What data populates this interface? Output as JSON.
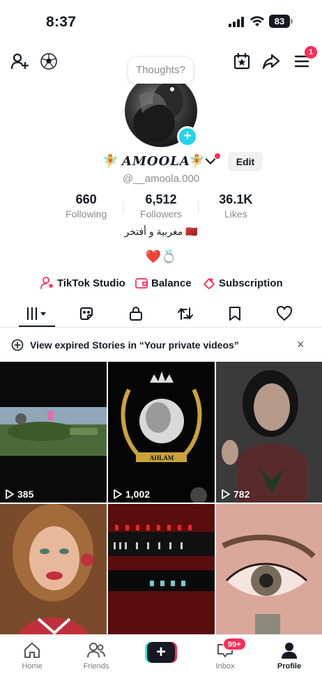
{
  "status_bar": {
    "time": "8:37",
    "battery": "83"
  },
  "top_nav": {
    "menu_badge": "1",
    "thought_bubble": "Thoughts?"
  },
  "profile": {
    "display_name": "AMOOLA",
    "username": "@__amoola.000",
    "edit_label": "Edit",
    "stats": [
      {
        "value": "660",
        "label": "Following"
      },
      {
        "value": "6,512",
        "label": "Followers"
      },
      {
        "value": "36.1K",
        "label": "Likes"
      }
    ],
    "bio_line1": "مغربية و أفتخر 🇲🇦",
    "bio_line2": "❤️💍"
  },
  "links": [
    {
      "label": "TikTok Studio",
      "icon": "person-star-icon"
    },
    {
      "label": "Balance",
      "icon": "wallet-icon"
    },
    {
      "label": "Subscription",
      "icon": "subscription-icon"
    }
  ],
  "tabs": [
    "videos-grid-icon",
    "stickers-icon",
    "lock-icon",
    "repost-icon",
    "bookmark-icon",
    "heart-icon"
  ],
  "banner": {
    "text": "View expired Stories in “Your private videos”"
  },
  "videos": [
    {
      "views": "385",
      "theme": "game"
    },
    {
      "views": "1,002",
      "theme": "crest"
    },
    {
      "views": "782",
      "theme": "portrait-dark"
    },
    {
      "views": "",
      "theme": "portrait-red"
    },
    {
      "views": "",
      "theme": "abstract-red"
    },
    {
      "views": "",
      "theme": "eye-closeup"
    }
  ],
  "bottom_nav": {
    "home": "Home",
    "friends": "Friends",
    "inbox": "Inbox",
    "inbox_badge": "99+",
    "profile": "Profile"
  },
  "colors": {
    "accent": "#fe2c55",
    "cyan": "#25f4ee",
    "text": "#161823",
    "muted": "#8a8b91"
  }
}
